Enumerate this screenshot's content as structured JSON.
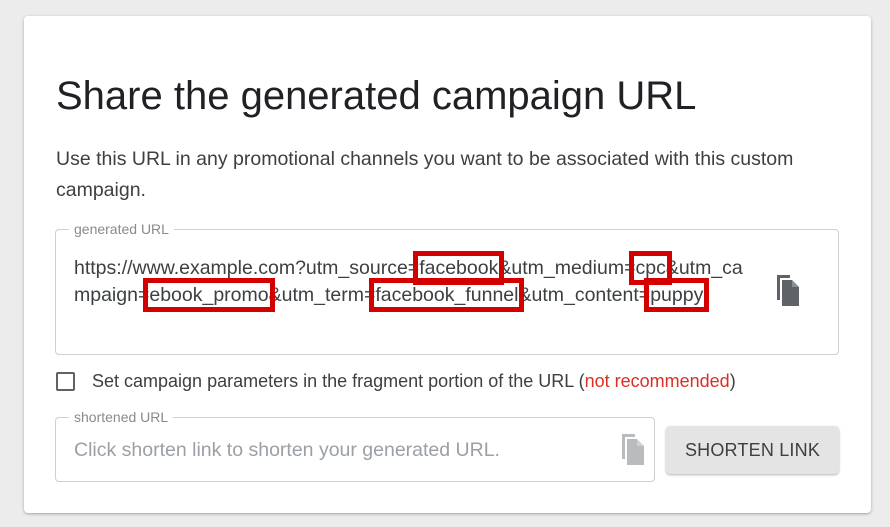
{
  "header": {
    "title": "Share the generated campaign URL",
    "description": "Use this URL in any promotional channels you want to be associated with this custom campaign."
  },
  "generated_url": {
    "legend": "generated URL",
    "segments": {
      "base": "https://www.example.com?utm_source=",
      "source": "facebook",
      "medium_key": "&utm_medium=",
      "medium": "cpc",
      "campaign_key": "&utm_campaign=",
      "campaign": "ebook_promo",
      "term_key": "&utm_term=",
      "term": "facebook_funnel",
      "content_key": "&utm_content=",
      "content": "puppy"
    },
    "copy_icon": "copy-icon"
  },
  "fragment_option": {
    "checked": false,
    "label": "Set campaign parameters in the fragment portion of the URL (",
    "warning": "not recommended",
    "close": ")"
  },
  "shortened_url": {
    "legend": "shortened URL",
    "placeholder": "Click shorten link to shorten your generated URL.",
    "copy_icon": "copy-icon"
  },
  "shorten_button": {
    "label": "SHORTEN LINK"
  },
  "colors": {
    "highlight": "#d40000",
    "warning": "#d93025",
    "text": "#3c4043",
    "icon": "#5f6368"
  }
}
